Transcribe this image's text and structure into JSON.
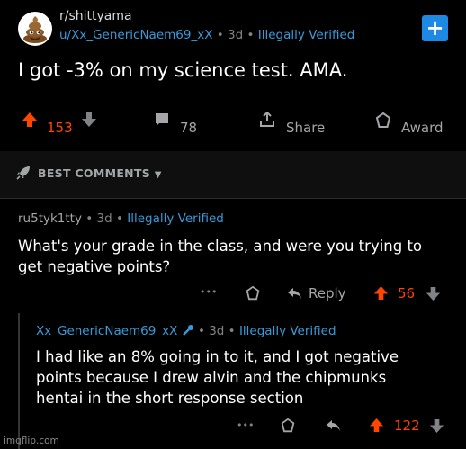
{
  "post": {
    "subreddit": "r/shittyama",
    "author": "u/Xx_GenericNaem69_xX",
    "time": "3d",
    "flair": "Illegally Verified",
    "title": "I got -3% on my science test. AMA.",
    "upvotes": "153",
    "comments": "78",
    "share_label": "Share",
    "award_label": "Award",
    "avatar_icon": "poop-emoji-icon"
  },
  "sort": {
    "label": "BEST COMMENTS"
  },
  "comments": [
    {
      "author": "ru5tyk1tty",
      "time": "3d",
      "flair": "Illegally Verified",
      "line1": "What's your grade in the class, and were you trying to",
      "line2": "get negative points?",
      "more": "•••",
      "reply_label": "Reply",
      "score": "56"
    },
    {
      "author": "Xx_GenericNaem69_xX",
      "time": "3d",
      "flair": "Illegally Verified",
      "line1": "I had like an 8% going in to it, and I got negative",
      "line2": "points because I drew alvin and the chipmunks",
      "line3": "hentai in the short response section",
      "more": "•••",
      "score": "122"
    }
  ],
  "watermark": "imgflip.com",
  "colors": {
    "upvote": "#ff4500",
    "link": "#3a9ad9",
    "plus_button": "#1e88e5",
    "background": "#000000"
  }
}
